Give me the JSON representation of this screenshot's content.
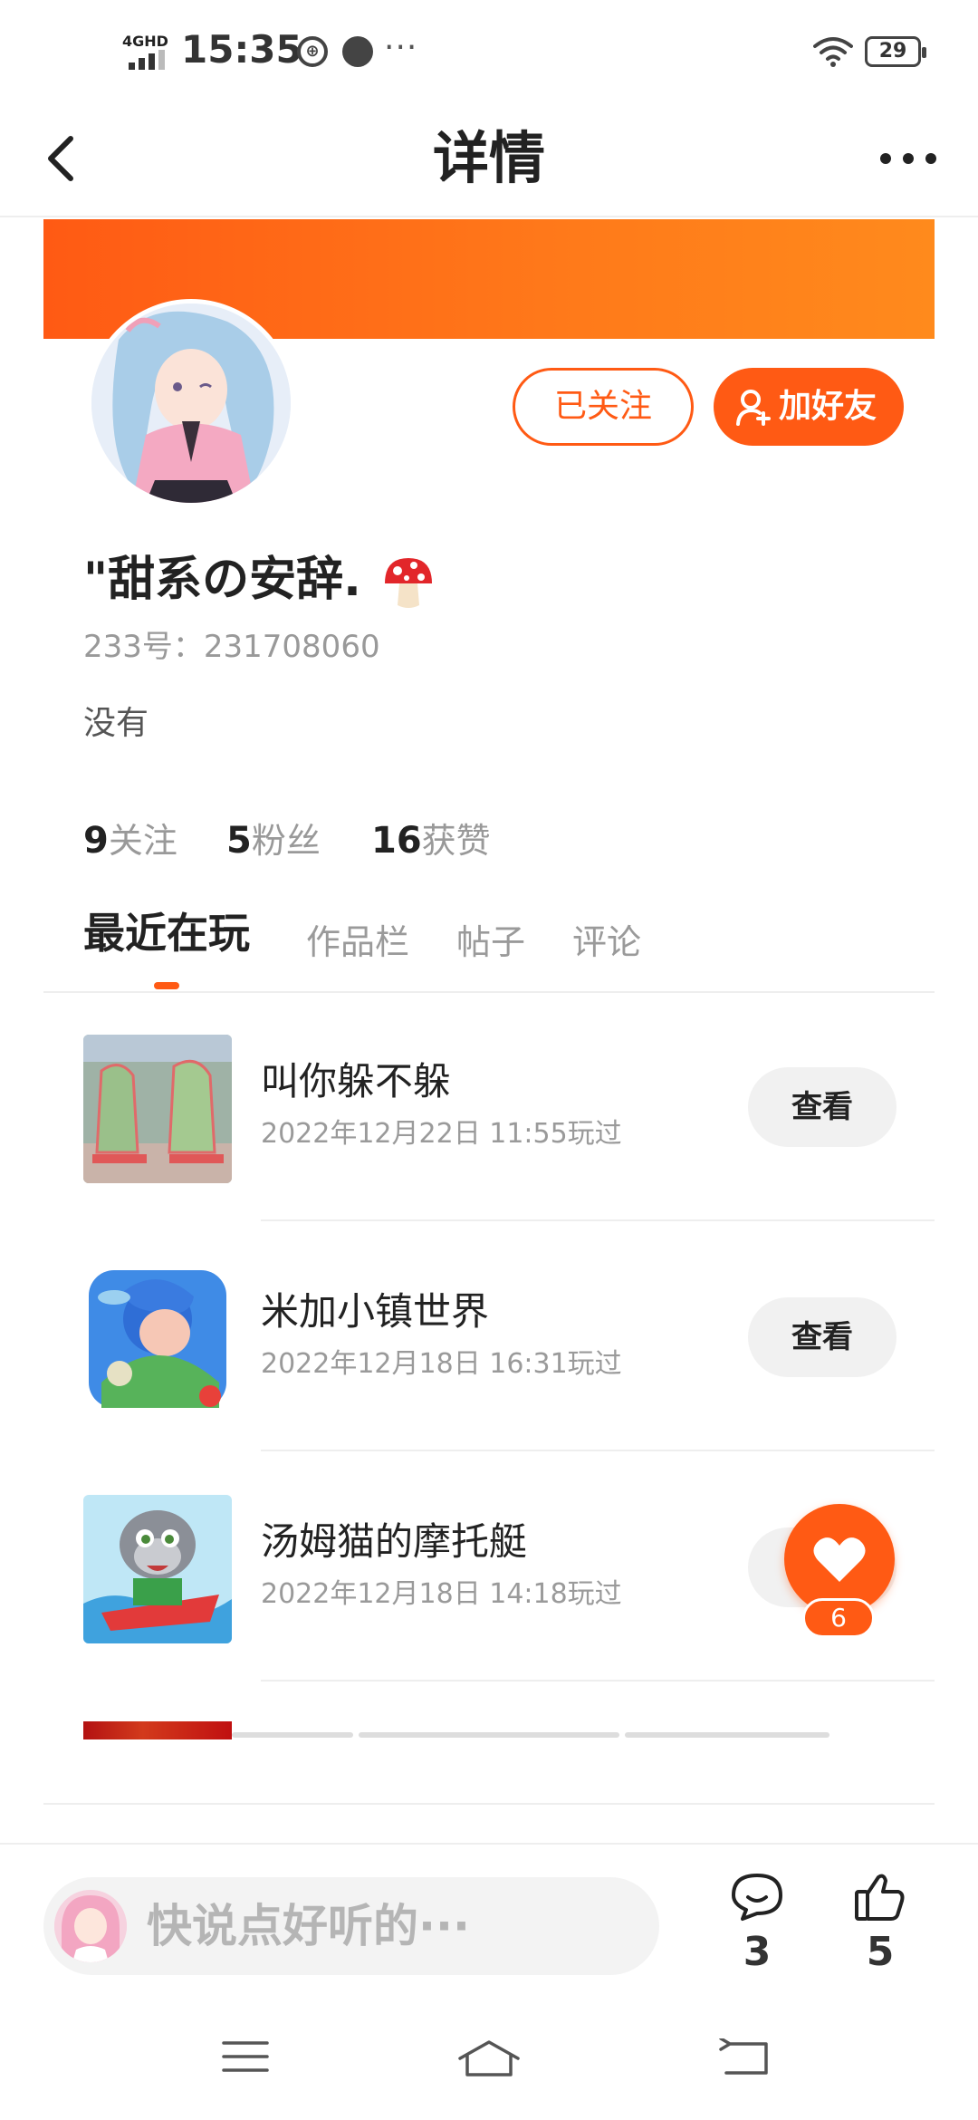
{
  "status_bar": {
    "network": "4GHD",
    "time": "15:35",
    "battery": "29",
    "more": "···"
  },
  "header": {
    "title": "详情"
  },
  "profile": {
    "followed_label": "已关注",
    "add_friend_label": "加好友",
    "nickname": "\"甜系の安辞.",
    "id_text": "233号：231708060",
    "bio": "没有",
    "stats": [
      {
        "value": "9",
        "label": "关注"
      },
      {
        "value": "5",
        "label": "粉丝"
      },
      {
        "value": "16",
        "label": "获赞"
      }
    ]
  },
  "tabs": [
    {
      "label": "最近在玩",
      "active": true
    },
    {
      "label": "作品栏",
      "active": false
    },
    {
      "label": "帖子",
      "active": false
    },
    {
      "label": "评论",
      "active": false
    }
  ],
  "recent_games": [
    {
      "name": "叫你躲不躲",
      "time": "2022年12月22日 11:55玩过",
      "button": "查看"
    },
    {
      "name": "米加小镇世界",
      "time": "2022年12月18日 16:31玩过",
      "button": "查看"
    },
    {
      "name": "汤姆猫的摩托艇",
      "time": "2022年12月18日 14:18玩过",
      "button": "查看"
    }
  ],
  "floating_like": {
    "count": "6"
  },
  "bottom": {
    "comment_placeholder": "快说点好听的···",
    "comment_count": "3",
    "like_count": "5"
  },
  "colors": {
    "accent": "#ff5a14",
    "text_primary": "#222222",
    "text_secondary": "#999999"
  }
}
